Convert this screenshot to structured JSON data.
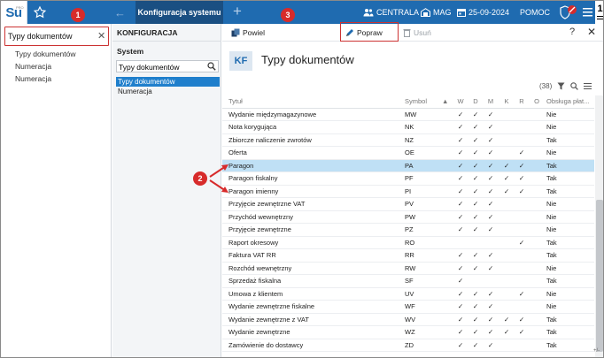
{
  "app": {
    "logo_text": "Su",
    "logo_sub": "PRO",
    "active_tab": "Konfiguracja systemu",
    "new_tab_label": "+",
    "top_items": [
      {
        "name": "company",
        "label": "CENTRALA"
      },
      {
        "name": "warehouse",
        "label": "MAG"
      },
      {
        "name": "date",
        "label": "25-09-2024"
      },
      {
        "name": "help",
        "label": "POMOC"
      }
    ],
    "user_badge": "1",
    "accent_color": "#1f6bb0"
  },
  "left_panel": {
    "search_value": "Typy dokumentów",
    "clear_label": "✕",
    "items": [
      "Typy dokumentów",
      "Numeracja",
      "Numeracja"
    ]
  },
  "config_panel": {
    "title": "KONFIGURACJA",
    "group": "System",
    "search_value": "Typy dokumentów",
    "items": [
      "Typy dokumentów",
      "Numeracja"
    ],
    "selected_index": 0
  },
  "toolbar": {
    "buttons": [
      {
        "name": "powiel",
        "label": "Powiel",
        "disabled": false
      },
      {
        "name": "popraw",
        "label": "Popraw",
        "disabled": false
      },
      {
        "name": "usun",
        "label": "Usuń",
        "disabled": true
      }
    ],
    "help_label": "?",
    "close_label": "✕"
  },
  "page": {
    "badge": "KF",
    "title": "Typy dokumentów",
    "record_count": "(38)"
  },
  "table": {
    "columns": [
      "Tytuł",
      "Symbol",
      "W",
      "D",
      "M",
      "K",
      "R",
      "O",
      "Obsługa płat..."
    ],
    "sort_indicator": "▲",
    "check_glyph": "✓",
    "selected_row": 4,
    "rows": [
      {
        "name": "Wydanie międzymagazynowe",
        "symbol": "MW",
        "flags": [
          1,
          1,
          1,
          0,
          0,
          0
        ],
        "obs": "Nie"
      },
      {
        "name": "Nota korygująca",
        "symbol": "NK",
        "flags": [
          1,
          1,
          1,
          0,
          0,
          0
        ],
        "obs": "Nie"
      },
      {
        "name": "Zbiorcze naliczenie zwrotów",
        "symbol": "NZ",
        "flags": [
          1,
          1,
          1,
          0,
          0,
          0
        ],
        "obs": "Tak"
      },
      {
        "name": "Oferta",
        "symbol": "OE",
        "flags": [
          1,
          1,
          1,
          0,
          1,
          0
        ],
        "obs": "Nie"
      },
      {
        "name": "Paragon",
        "symbol": "PA",
        "flags": [
          1,
          1,
          1,
          1,
          1,
          0
        ],
        "obs": "Tak"
      },
      {
        "name": "Paragon fiskalny",
        "symbol": "PF",
        "flags": [
          1,
          1,
          1,
          1,
          1,
          0
        ],
        "obs": "Tak"
      },
      {
        "name": "Paragon imienny",
        "symbol": "PI",
        "flags": [
          1,
          1,
          1,
          1,
          1,
          0
        ],
        "obs": "Tak"
      },
      {
        "name": "Przyjęcie zewnętrzne VAT",
        "symbol": "PV",
        "flags": [
          1,
          1,
          1,
          0,
          0,
          0
        ],
        "obs": "Nie"
      },
      {
        "name": "Przychód wewnętrzny",
        "symbol": "PW",
        "flags": [
          1,
          1,
          1,
          0,
          0,
          0
        ],
        "obs": "Nie"
      },
      {
        "name": "Przyjęcie zewnętrzne",
        "symbol": "PZ",
        "flags": [
          1,
          1,
          1,
          0,
          0,
          0
        ],
        "obs": "Nie"
      },
      {
        "name": "Raport okresowy",
        "symbol": "RO",
        "flags": [
          0,
          0,
          0,
          0,
          1,
          0
        ],
        "obs": "Tak"
      },
      {
        "name": "Faktura VAT RR",
        "symbol": "RR",
        "flags": [
          1,
          1,
          1,
          0,
          0,
          0
        ],
        "obs": "Tak"
      },
      {
        "name": "Rozchód wewnętrzny",
        "symbol": "RW",
        "flags": [
          1,
          1,
          1,
          0,
          0,
          0
        ],
        "obs": "Nie"
      },
      {
        "name": "Sprzedaż fiskalna",
        "symbol": "SF",
        "flags": [
          1,
          0,
          0,
          0,
          0,
          0
        ],
        "obs": "Tak"
      },
      {
        "name": "Umowa z klientem",
        "symbol": "UV",
        "flags": [
          1,
          1,
          1,
          0,
          1,
          0
        ],
        "obs": "Nie"
      },
      {
        "name": "Wydanie zewnętrzne fiskalne",
        "symbol": "WF",
        "flags": [
          1,
          1,
          1,
          0,
          0,
          0
        ],
        "obs": "Nie"
      },
      {
        "name": "Wydanie zewnętrzne z VAT",
        "symbol": "WV",
        "flags": [
          1,
          1,
          1,
          1,
          1,
          0
        ],
        "obs": "Tak"
      },
      {
        "name": "Wydanie zewnętrzne",
        "symbol": "WZ",
        "flags": [
          1,
          1,
          1,
          1,
          1,
          0
        ],
        "obs": "Tak"
      },
      {
        "name": "Zamówienie do dostawcy",
        "symbol": "ZD",
        "flags": [
          1,
          1,
          1,
          0,
          0,
          0
        ],
        "obs": "Tak"
      }
    ]
  },
  "annotations": {
    "markers": [
      {
        "label": "1"
      },
      {
        "label": "2"
      },
      {
        "label": "3"
      }
    ],
    "color": "#d72b2b"
  }
}
